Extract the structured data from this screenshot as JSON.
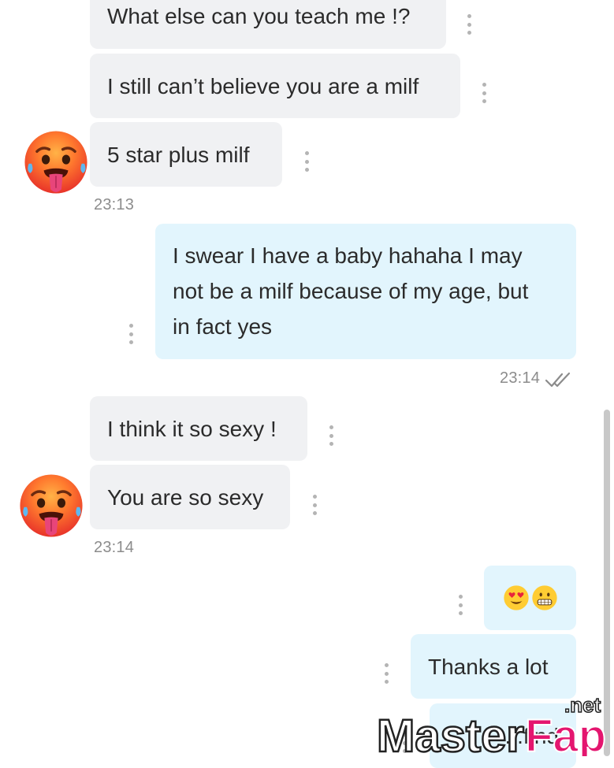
{
  "messages": [
    {
      "text": "What else can you teach me !?",
      "side": "in"
    },
    {
      "text": "I still can’t believe you are a milf",
      "side": "in"
    },
    {
      "text": "5 star plus milf",
      "side": "in"
    },
    {
      "text": "I swear I have a baby hahaha I may not be a milf because of my age, but in fact yes",
      "lines": [
        "I swear I have a baby hahaha I may",
        "not be a milf because of my age, but",
        "in fact yes"
      ],
      "side": "out"
    },
    {
      "text": "I think it so sexy !",
      "side": "in"
    },
    {
      "text": "You are so sexy",
      "side": "in"
    },
    {
      "text": "😍😬",
      "side": "out"
    },
    {
      "text": "Thanks a lot",
      "side": "out"
    },
    {
      "text": "...find",
      "side": "out"
    }
  ],
  "timestamps": {
    "first": "23:13",
    "sent": "23:14",
    "second": "23:14"
  },
  "read_receipt_icon": "double-check-icon",
  "avatar_icon": "hot-face-emoji",
  "watermark": {
    "master": "Master",
    "fap": "Fap",
    "tld": ".net"
  },
  "colors": {
    "incoming_bubble": "#f0f1f3",
    "outgoing_bubble": "#e2f5fd",
    "text": "#2b2b2b",
    "timestamp": "#8c8c8c",
    "watermark_fap": "#e4166f"
  }
}
